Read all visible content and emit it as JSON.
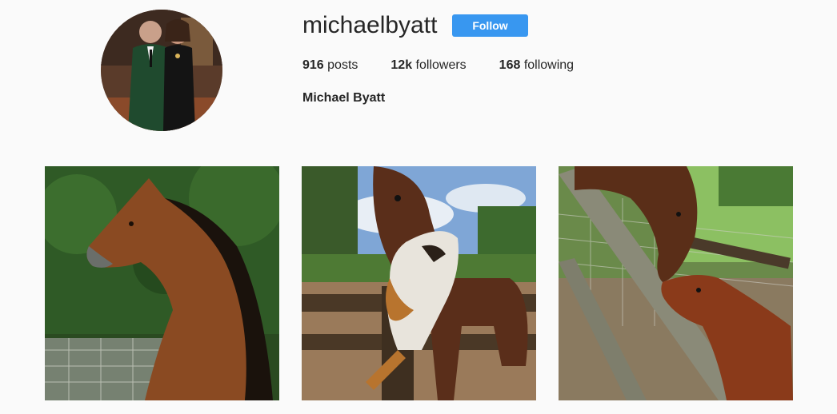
{
  "profile": {
    "username": "michaelbyatt",
    "follow_label": "Follow",
    "full_name": "Michael Byatt",
    "stats": {
      "posts_count": "916",
      "posts_label": " posts",
      "followers_count": "12k",
      "followers_label": " followers",
      "following_count": "168",
      "following_label": " following"
    }
  },
  "colors": {
    "follow_button": "#3897f0",
    "background": "#fafafa",
    "text": "#262626"
  },
  "posts": [
    {
      "subject": "bay Arabian horse in profile"
    },
    {
      "subject": "horse and calico cat at fence"
    },
    {
      "subject": "horse and calf at wooden fence"
    }
  ]
}
